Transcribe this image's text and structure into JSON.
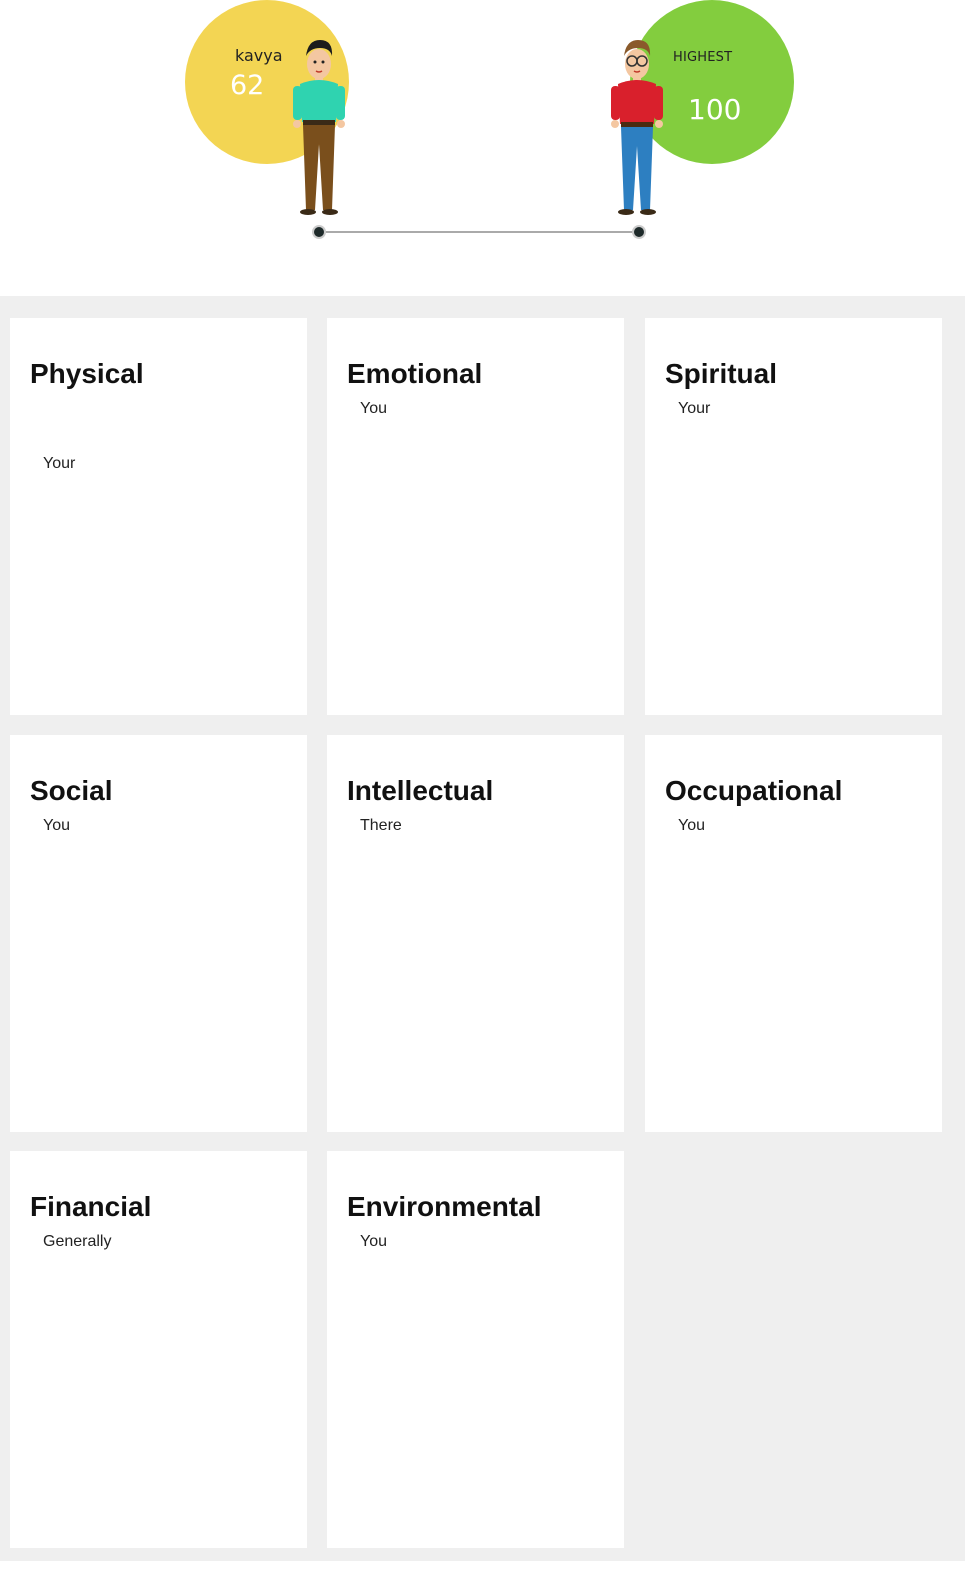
{
  "comparison": {
    "user": {
      "name": "kavya",
      "score": "62"
    },
    "top": {
      "label": "HIGHEST",
      "score": "100"
    }
  },
  "dimensions": [
    {
      "title": "Physical",
      "text": "Your"
    },
    {
      "title": "Emotional",
      "text": "You"
    },
    {
      "title": "Spiritual",
      "text": "Your"
    },
    {
      "title": "Social",
      "text": "You"
    },
    {
      "title": "Intellectual",
      "text": "There"
    },
    {
      "title": "Occupational",
      "text": "You"
    },
    {
      "title": "Financial",
      "text": "Generally"
    },
    {
      "title": "Environmental",
      "text": "You"
    }
  ],
  "colors": {
    "user_bubble": "#f3d553",
    "top_bubble": "#83cd3e",
    "page_bg": "#efefef"
  }
}
